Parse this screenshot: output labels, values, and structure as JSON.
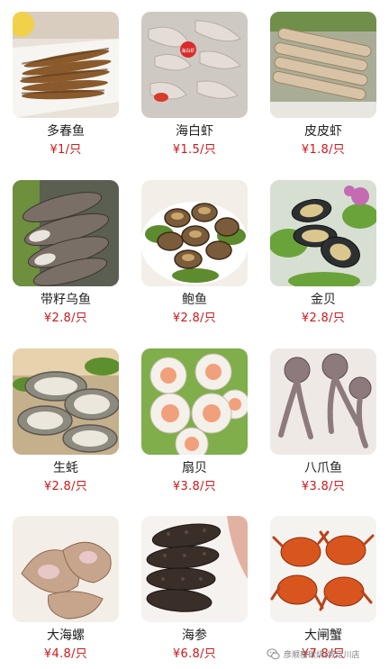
{
  "currency_symbol": "¥",
  "items": [
    {
      "name": "多春鱼",
      "price": "¥1/只",
      "image": "fish-skewers"
    },
    {
      "name": "海白虾",
      "price": "¥1.5/只",
      "image": "white-shrimp"
    },
    {
      "name": "皮皮虾",
      "price": "¥1.8/只",
      "image": "mantis-shrimp"
    },
    {
      "name": "带籽乌鱼",
      "price": "¥2.8/只",
      "image": "squid-with-roe"
    },
    {
      "name": "鲍鱼",
      "price": "¥2.8/只",
      "image": "abalone"
    },
    {
      "name": "金贝",
      "price": "¥2.8/只",
      "image": "mussels"
    },
    {
      "name": "生蚝",
      "price": "¥2.8/只",
      "image": "oysters"
    },
    {
      "name": "扇贝",
      "price": "¥3.8/只",
      "image": "scallops"
    },
    {
      "name": "八爪鱼",
      "price": "¥3.8/只",
      "image": "octopus"
    },
    {
      "name": "大海螺",
      "price": "¥4.8/只",
      "image": "conch"
    },
    {
      "name": "海参",
      "price": "¥6.8/只",
      "image": "sea-cucumber"
    },
    {
      "name": "大闸蟹",
      "price": "¥7.8/只",
      "image": "hairy-crab"
    }
  ],
  "watermark": {
    "text": "彦顺窑碳烧(城定川店",
    "icon": "wechat-icon"
  },
  "colors": {
    "price": "#d0161b",
    "name": "#222222",
    "background": "#ffffff"
  }
}
